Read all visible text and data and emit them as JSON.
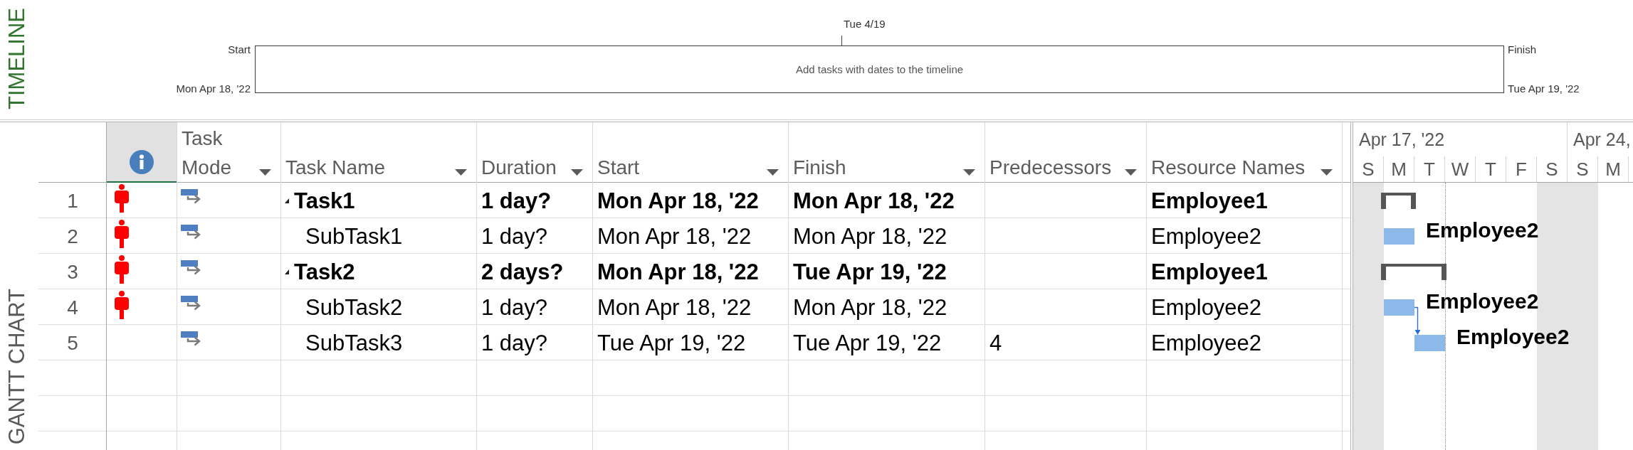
{
  "timeline": {
    "label": "TIMELINE",
    "tick_label": "Tue 4/19",
    "start_label": "Start",
    "start_date": "Mon Apr 18, '22",
    "message": "Add tasks with dates to the timeline",
    "finish_label": "Finish",
    "finish_date": "Tue Apr 19, '22"
  },
  "gantt": {
    "label": "GANTT CHART",
    "columns": [
      {
        "kind": "indicators",
        "selected": true
      },
      {
        "kind": "task_mode",
        "label": "Task Mode",
        "selected": false
      },
      {
        "kind": "task_name",
        "label": "Task Name",
        "selected": false
      },
      {
        "kind": "duration",
        "label": "Duration",
        "selected": false
      },
      {
        "kind": "start",
        "label": "Start",
        "selected": false
      },
      {
        "kind": "finish",
        "label": "Finish",
        "selected": false
      },
      {
        "kind": "predecessors",
        "label": "Predecessors",
        "selected": false
      },
      {
        "kind": "resource_names",
        "label": "Resource Names",
        "selected": false
      }
    ],
    "tasks": [
      {
        "id": "1",
        "overallocated": true,
        "name": "Task1",
        "expanded": true,
        "duration": "1 day?",
        "start": "Mon Apr 18, '22",
        "finish": "Mon Apr 18, '22",
        "resource_names": "Employee1",
        "children": [
          {
            "id": "2",
            "overallocated": true,
            "name": "SubTask1",
            "duration": "1 day?",
            "start": "Mon Apr 18, '22",
            "finish": "Mon Apr 18, '22",
            "resource_names": "Employee2"
          }
        ]
      },
      {
        "id": "3",
        "overallocated": true,
        "name": "Task2",
        "expanded": true,
        "duration": "2 days?",
        "start": "Mon Apr 18, '22",
        "finish": "Tue Apr 19, '22",
        "resource_names": "Employee1",
        "children": [
          {
            "id": "4",
            "overallocated": true,
            "name": "SubTask2",
            "duration": "1 day?",
            "start": "Mon Apr 18, '22",
            "finish": "Mon Apr 18, '22",
            "resource_names": "Employee2"
          },
          {
            "id": "5",
            "overallocated": false,
            "name": "SubTask3",
            "duration": "1 day?",
            "start": "Tue Apr 19, '22",
            "finish": "Tue Apr 19, '22",
            "predecessors": "4",
            "resource_names": "Employee2"
          }
        ]
      }
    ],
    "chart": {
      "week_labels": [
        "Apr 17, '22",
        "Apr 24,"
      ],
      "days": [
        {
          "label": "S",
          "nonworking": true
        },
        {
          "label": "M",
          "nonworking": false
        },
        {
          "label": "T",
          "nonworking": false
        },
        {
          "label": "W",
          "nonworking": false
        },
        {
          "label": "T",
          "nonworking": false
        },
        {
          "label": "F",
          "nonworking": false
        },
        {
          "label": "S",
          "nonworking": true
        },
        {
          "label": "S",
          "nonworking": true
        },
        {
          "label": "M",
          "nonworking": false
        }
      ],
      "bars": [
        {
          "kind": "summary"
        },
        {
          "kind": "task",
          "label": "Employee2"
        },
        {
          "kind": "summary"
        },
        {
          "kind": "task",
          "label": "Employee2"
        },
        {
          "kind": "task",
          "label": "Employee2"
        }
      ]
    }
  }
}
